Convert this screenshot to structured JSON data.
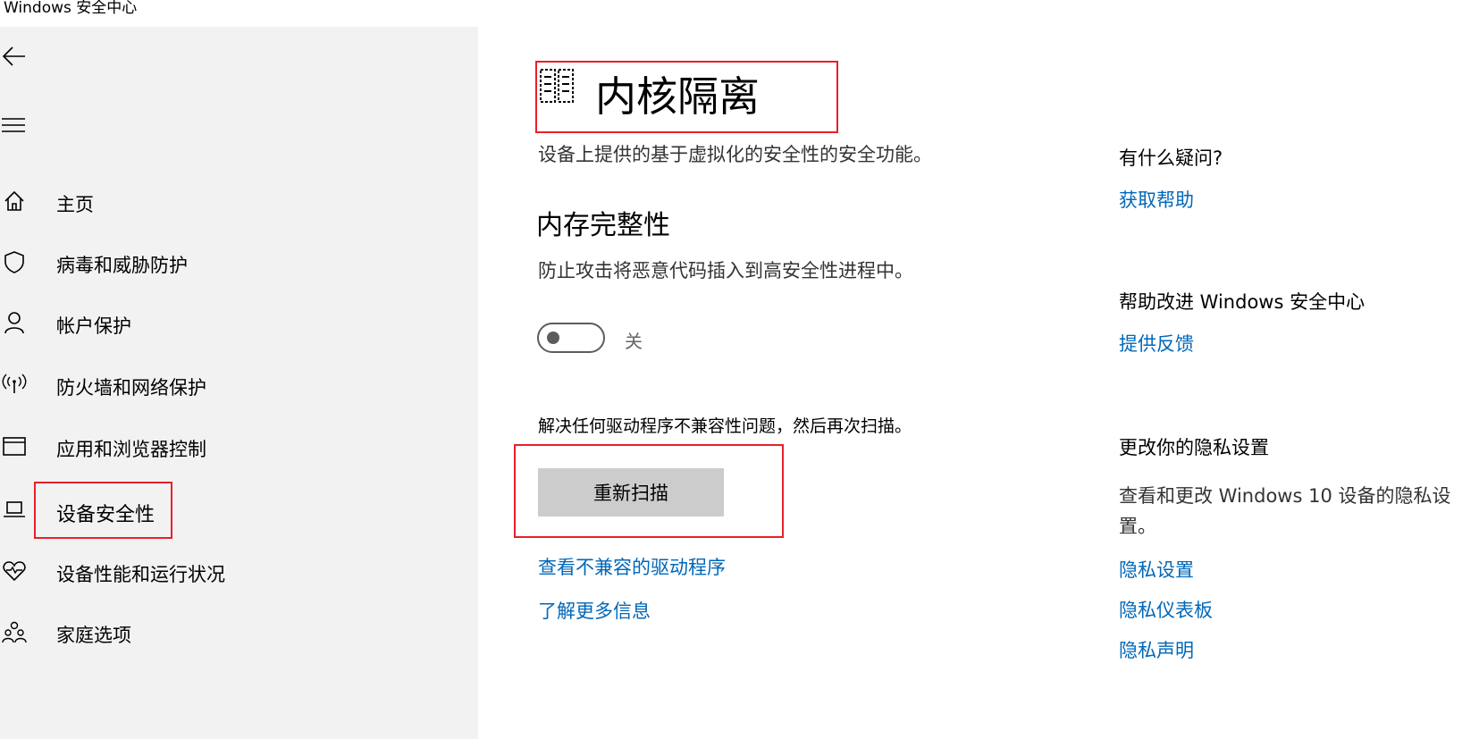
{
  "window": {
    "title": "Windows 安全中心"
  },
  "nav": {
    "items": [
      {
        "label": "主页",
        "icon": "home-icon"
      },
      {
        "label": "病毒和威胁防护",
        "icon": "shield-icon"
      },
      {
        "label": "帐户保护",
        "icon": "person-icon"
      },
      {
        "label": "防火墙和网络保护",
        "icon": "wifi-antenna-icon"
      },
      {
        "label": "应用和浏览器控制",
        "icon": "app-window-icon"
      },
      {
        "label": "设备安全性",
        "icon": "laptop-icon",
        "selected": true
      },
      {
        "label": "设备性能和运行状况",
        "icon": "heart-pulse-icon"
      },
      {
        "label": "家庭选项",
        "icon": "family-icon"
      }
    ]
  },
  "main": {
    "title": "内核隔离",
    "description": "设备上提供的基于虚拟化的安全性的安全功能。",
    "memory_integrity": {
      "title": "内存完整性",
      "description": "防止攻击将恶意代码插入到高安全性进程中。",
      "toggle_label": "关",
      "toggle_on": false
    },
    "driver_note": "解决任何驱动程序不兼容性问题，然后再次扫描。",
    "rescan_label": "重新扫描",
    "links": {
      "incompatible_drivers": "查看不兼容的驱动程序",
      "learn_more": "了解更多信息"
    }
  },
  "side": {
    "question_heading": "有什么疑问?",
    "get_help": "获取帮助",
    "improve_heading": "帮助改进 Windows 安全中心",
    "feedback": "提供反馈",
    "privacy_heading": "更改你的隐私设置",
    "privacy_text": "查看和更改 Windows 10 设备的隐私设置。",
    "privacy_links": [
      "隐私设置",
      "隐私仪表板",
      "隐私声明"
    ]
  },
  "colors": {
    "accent_link": "#0067b8",
    "annotation_red": "#e8202a",
    "sidebar_bg": "#f2f2f2"
  }
}
